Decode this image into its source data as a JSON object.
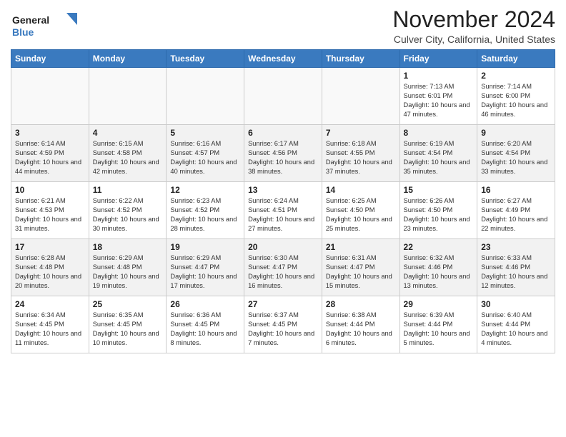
{
  "logo": {
    "line1": "General",
    "line2": "Blue"
  },
  "title": "November 2024",
  "location": "Culver City, California, United States",
  "days_of_week": [
    "Sunday",
    "Monday",
    "Tuesday",
    "Wednesday",
    "Thursday",
    "Friday",
    "Saturday"
  ],
  "weeks": [
    [
      {
        "day": "",
        "info": ""
      },
      {
        "day": "",
        "info": ""
      },
      {
        "day": "",
        "info": ""
      },
      {
        "day": "",
        "info": ""
      },
      {
        "day": "",
        "info": ""
      },
      {
        "day": "1",
        "info": "Sunrise: 7:13 AM\nSunset: 6:01 PM\nDaylight: 10 hours and 47 minutes."
      },
      {
        "day": "2",
        "info": "Sunrise: 7:14 AM\nSunset: 6:00 PM\nDaylight: 10 hours and 46 minutes."
      }
    ],
    [
      {
        "day": "3",
        "info": "Sunrise: 6:14 AM\nSunset: 4:59 PM\nDaylight: 10 hours and 44 minutes."
      },
      {
        "day": "4",
        "info": "Sunrise: 6:15 AM\nSunset: 4:58 PM\nDaylight: 10 hours and 42 minutes."
      },
      {
        "day": "5",
        "info": "Sunrise: 6:16 AM\nSunset: 4:57 PM\nDaylight: 10 hours and 40 minutes."
      },
      {
        "day": "6",
        "info": "Sunrise: 6:17 AM\nSunset: 4:56 PM\nDaylight: 10 hours and 38 minutes."
      },
      {
        "day": "7",
        "info": "Sunrise: 6:18 AM\nSunset: 4:55 PM\nDaylight: 10 hours and 37 minutes."
      },
      {
        "day": "8",
        "info": "Sunrise: 6:19 AM\nSunset: 4:54 PM\nDaylight: 10 hours and 35 minutes."
      },
      {
        "day": "9",
        "info": "Sunrise: 6:20 AM\nSunset: 4:54 PM\nDaylight: 10 hours and 33 minutes."
      }
    ],
    [
      {
        "day": "10",
        "info": "Sunrise: 6:21 AM\nSunset: 4:53 PM\nDaylight: 10 hours and 31 minutes."
      },
      {
        "day": "11",
        "info": "Sunrise: 6:22 AM\nSunset: 4:52 PM\nDaylight: 10 hours and 30 minutes."
      },
      {
        "day": "12",
        "info": "Sunrise: 6:23 AM\nSunset: 4:52 PM\nDaylight: 10 hours and 28 minutes."
      },
      {
        "day": "13",
        "info": "Sunrise: 6:24 AM\nSunset: 4:51 PM\nDaylight: 10 hours and 27 minutes."
      },
      {
        "day": "14",
        "info": "Sunrise: 6:25 AM\nSunset: 4:50 PM\nDaylight: 10 hours and 25 minutes."
      },
      {
        "day": "15",
        "info": "Sunrise: 6:26 AM\nSunset: 4:50 PM\nDaylight: 10 hours and 23 minutes."
      },
      {
        "day": "16",
        "info": "Sunrise: 6:27 AM\nSunset: 4:49 PM\nDaylight: 10 hours and 22 minutes."
      }
    ],
    [
      {
        "day": "17",
        "info": "Sunrise: 6:28 AM\nSunset: 4:48 PM\nDaylight: 10 hours and 20 minutes."
      },
      {
        "day": "18",
        "info": "Sunrise: 6:29 AM\nSunset: 4:48 PM\nDaylight: 10 hours and 19 minutes."
      },
      {
        "day": "19",
        "info": "Sunrise: 6:29 AM\nSunset: 4:47 PM\nDaylight: 10 hours and 17 minutes."
      },
      {
        "day": "20",
        "info": "Sunrise: 6:30 AM\nSunset: 4:47 PM\nDaylight: 10 hours and 16 minutes."
      },
      {
        "day": "21",
        "info": "Sunrise: 6:31 AM\nSunset: 4:47 PM\nDaylight: 10 hours and 15 minutes."
      },
      {
        "day": "22",
        "info": "Sunrise: 6:32 AM\nSunset: 4:46 PM\nDaylight: 10 hours and 13 minutes."
      },
      {
        "day": "23",
        "info": "Sunrise: 6:33 AM\nSunset: 4:46 PM\nDaylight: 10 hours and 12 minutes."
      }
    ],
    [
      {
        "day": "24",
        "info": "Sunrise: 6:34 AM\nSunset: 4:45 PM\nDaylight: 10 hours and 11 minutes."
      },
      {
        "day": "25",
        "info": "Sunrise: 6:35 AM\nSunset: 4:45 PM\nDaylight: 10 hours and 10 minutes."
      },
      {
        "day": "26",
        "info": "Sunrise: 6:36 AM\nSunset: 4:45 PM\nDaylight: 10 hours and 8 minutes."
      },
      {
        "day": "27",
        "info": "Sunrise: 6:37 AM\nSunset: 4:45 PM\nDaylight: 10 hours and 7 minutes."
      },
      {
        "day": "28",
        "info": "Sunrise: 6:38 AM\nSunset: 4:44 PM\nDaylight: 10 hours and 6 minutes."
      },
      {
        "day": "29",
        "info": "Sunrise: 6:39 AM\nSunset: 4:44 PM\nDaylight: 10 hours and 5 minutes."
      },
      {
        "day": "30",
        "info": "Sunrise: 6:40 AM\nSunset: 4:44 PM\nDaylight: 10 hours and 4 minutes."
      }
    ]
  ]
}
